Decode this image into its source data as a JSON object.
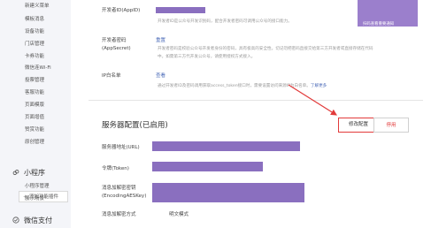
{
  "sidebar": {
    "items": [
      "新建义菜单",
      "模板消息",
      "设备功能",
      "门店管理",
      "卡券功能",
      "微信连Wi-Fi",
      "投票管理",
      "客服功能",
      "页面模版",
      "页面增值",
      "赞赏功能",
      "原创管理"
    ],
    "add_plugin": "添加功能插件",
    "mini_program": {
      "title": "小程序",
      "items": [
        "小程序管理",
        "展示场景"
      ]
    },
    "wechat_pay": "微信支付"
  },
  "developer": {
    "appid_label": "开发者ID(AppID)",
    "appid_desc": "开发者ID是公众号开发识别码，配合开发者密码可调用公众号的接口能力。",
    "secret_label": "开发者密码",
    "secret_sub": "(AppSecret)",
    "reset_link": "重置",
    "secret_desc_1": "开发者密码是校验公众号开发者身份的密码，具有极高的安全性。切记勿把密码直接交给第三方开发者或直接存储在代码",
    "secret_desc_2": "中。如需第三方代开发公众号，请使用授权方式接入。",
    "whitelist_label": "IP白名单",
    "view_link": "查看",
    "whitelist_desc": "通过开发者ID及密码调用获取access_token接口时，需要设置访问来源IP为白名单。",
    "learn_more": "了解更多",
    "qr_caption": "扫码查看重要通知"
  },
  "server": {
    "title": "服务器配置(已启用)",
    "modify_button": "修改配置",
    "disable_button": "停用",
    "url_label": "服务器地址(URL)",
    "token_label": "令牌(Token)",
    "aes_label_1": "消息加解密密钥",
    "aes_label_2": "(EncodingAESKey)",
    "mode_label": "消息加解密方式",
    "mode_value": "明文模式"
  },
  "colors": {
    "accent_red": "#e23a3a",
    "redaction_purple": "#8a6fbf",
    "link_blue": "#4a6ab8"
  }
}
